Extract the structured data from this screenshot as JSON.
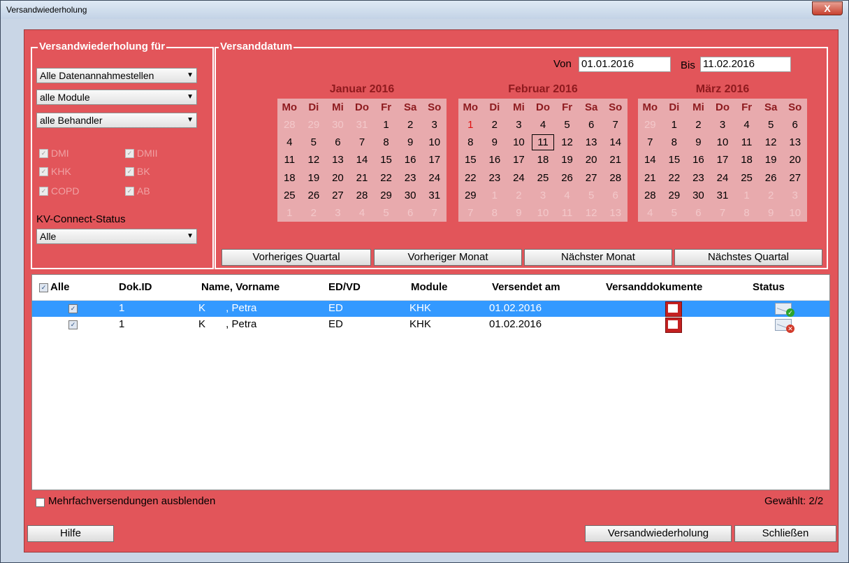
{
  "window": {
    "title": "Versandwiederholung",
    "close_label": "X"
  },
  "filter_group": {
    "legend": "Versandwiederholung für",
    "combo_stelle": "Alle Datenannahmestellen",
    "combo_module": "alle Module",
    "combo_behandler": "alle Behandler",
    "module_checks": [
      "DMI",
      "DMII",
      "KHK",
      "BK",
      "COPD",
      "AB"
    ],
    "kv_label": "KV-Connect-Status",
    "kv_value": "Alle"
  },
  "date_group": {
    "legend": "Versanddatum",
    "von_label": "Von",
    "von_value": "01.01.2016",
    "bis_label": "Bis",
    "bis_value": "11.02.2016",
    "weekdays": [
      "Mo",
      "Di",
      "Mi",
      "Do",
      "Fr",
      "Sa",
      "So"
    ],
    "months": [
      {
        "title": "Januar 2016",
        "days": [
          "28",
          "29",
          "30",
          "31",
          "1",
          "2",
          "3",
          "4",
          "5",
          "6",
          "7",
          "8",
          "9",
          "10",
          "11",
          "12",
          "13",
          "14",
          "15",
          "16",
          "17",
          "18",
          "19",
          "20",
          "21",
          "22",
          "23",
          "24",
          "25",
          "26",
          "27",
          "28",
          "29",
          "30",
          "31",
          "1",
          "2",
          "3",
          "4",
          "5",
          "6",
          "7"
        ],
        "in_month_start": 4,
        "in_month_end": 34
      },
      {
        "title": "Februar 2016",
        "days": [
          "1",
          "2",
          "3",
          "4",
          "5",
          "6",
          "7",
          "8",
          "9",
          "10",
          "11",
          "12",
          "13",
          "14",
          "15",
          "16",
          "17",
          "18",
          "19",
          "20",
          "21",
          "22",
          "23",
          "24",
          "25",
          "26",
          "27",
          "28",
          "29",
          "1",
          "2",
          "3",
          "4",
          "5",
          "6",
          "7",
          "8",
          "9",
          "10",
          "11",
          "12",
          "13"
        ],
        "in_month_start": 0,
        "in_month_end": 28
      },
      {
        "title": "März 2016",
        "days": [
          "29",
          "1",
          "2",
          "3",
          "4",
          "5",
          "6",
          "7",
          "8",
          "9",
          "10",
          "11",
          "12",
          "13",
          "14",
          "15",
          "16",
          "17",
          "18",
          "19",
          "20",
          "21",
          "22",
          "23",
          "24",
          "25",
          "26",
          "27",
          "28",
          "29",
          "30",
          "31",
          "1",
          "2",
          "3",
          "4",
          "5",
          "6",
          "7",
          "8",
          "9",
          "10"
        ],
        "in_month_start": 1,
        "in_month_end": 31
      }
    ],
    "btn_prev_quarter": "Vorheriges Quartal",
    "btn_prev_month": "Vorheriger Monat",
    "btn_next_month": "Nächster Monat",
    "btn_next_quarter": "Nächstes Quartal"
  },
  "table": {
    "headers": [
      "Alle",
      "Dok.ID",
      "Name, Vorname",
      "ED/VD",
      "Module",
      "Versendet am",
      "Versanddokumente",
      "Status"
    ],
    "rows": [
      {
        "dokid": "1",
        "name": "K       , Petra",
        "edvd": "ED",
        "module": "KHK",
        "date": "01.02.2016",
        "status": "ok"
      },
      {
        "dokid": "1",
        "name": "K       , Petra",
        "edvd": "ED",
        "module": "KHK",
        "date": "01.02.2016",
        "status": "error"
      }
    ]
  },
  "footer": {
    "hide_multi_label": "Mehrfachversendungen ausblenden",
    "selected_label": "Gewählt: 2/2",
    "help_label": "Hilfe",
    "resend_label": "Versandwiederholung",
    "close_label": "Schließen"
  },
  "colors": {
    "client_bg": "#e2555a",
    "calendar_bg": "#e8aaad",
    "selection": "#3399ff",
    "month_title": "#8e1a1e"
  }
}
